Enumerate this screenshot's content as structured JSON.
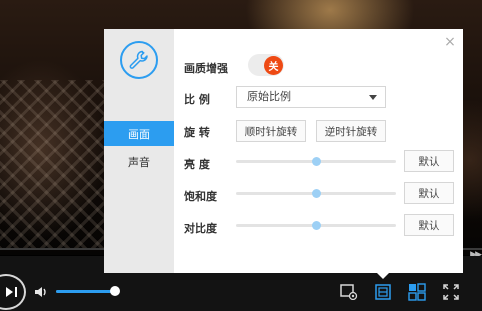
{
  "panel": {
    "title_tab_active": "画面",
    "title_tab_other": "声音",
    "enhance": {
      "label": "画质增强",
      "toggle_state": "关"
    },
    "ratio": {
      "label": "比 例",
      "selected": "原始比例"
    },
    "rotate": {
      "label": "旋 转",
      "clockwise": "顺时针旋转",
      "counterclockwise": "逆时针旋转"
    },
    "brightness": {
      "label": "亮 度",
      "value": 50,
      "default_label": "默认"
    },
    "saturation": {
      "label": "饱和度",
      "value": 50,
      "default_label": "默认"
    },
    "contrast": {
      "label": "对比度",
      "value": 50,
      "default_label": "默认"
    },
    "close_icon": "×"
  },
  "player": {
    "volume_level": 0.92,
    "icons": [
      "play-pause-icon",
      "volume-icon",
      "screenshot-icon",
      "picture-settings-icon",
      "layout-icon",
      "fullscreen-icon"
    ]
  },
  "colors": {
    "accent": "#2c9df0",
    "toggle_off": "#ee4a14"
  }
}
